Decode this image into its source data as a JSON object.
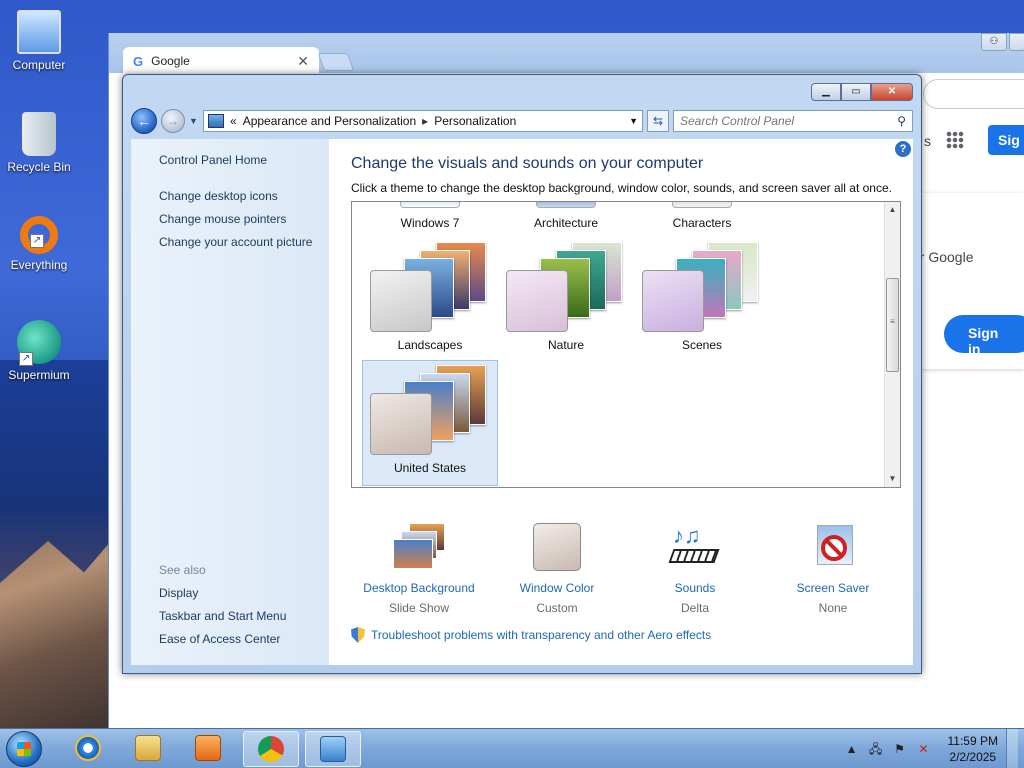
{
  "desktop": {
    "icons": [
      {
        "label": "Computer",
        "icon": "computer-icon"
      },
      {
        "label": "Recycle Bin",
        "icon": "recycle-bin-icon"
      },
      {
        "label": "Everything",
        "icon": "everything-icon"
      },
      {
        "label": "Supermium",
        "icon": "supermium-icon"
      }
    ]
  },
  "chrome": {
    "tab_title": "Google",
    "tab_favicon": "G",
    "apps_icon": "apps-grid-icon",
    "sign_in_small": "Sig",
    "card_text": "ur Google",
    "card_sign_in": "Sign in",
    "partial_s": "s",
    "colors": {
      "accent": "#1a73e8"
    }
  },
  "window": {
    "buttons": {
      "minimize": "▁",
      "maximize": "▭",
      "close": "✕"
    },
    "breadcrumb": {
      "chevrons": "«",
      "items": [
        "Appearance and Personalization",
        "Personalization"
      ],
      "separator": "▸"
    },
    "search_placeholder": "Search Control Panel"
  },
  "sidebar": {
    "home": "Control Panel Home",
    "links": [
      "Change desktop icons",
      "Change mouse pointers",
      "Change your account picture"
    ],
    "see_also_header": "See also",
    "see_also": [
      "Display",
      "Taskbar and Start Menu",
      "Ease of Access Center"
    ]
  },
  "main": {
    "title": "Change the visuals and sounds on your computer",
    "description": "Click a theme to change the desktop background, window color, sounds, and screen saver all at once.",
    "themes_row1": [
      "Windows 7",
      "Architecture",
      "Characters"
    ],
    "themes_row2": [
      "Landscapes",
      "Nature",
      "Scenes"
    ],
    "themes_row3": [
      "United States"
    ],
    "selected_theme": "United States",
    "bottom_options": [
      {
        "label": "Desktop Background",
        "value": "Slide Show",
        "icon": "desktop-background-icon"
      },
      {
        "label": "Window Color",
        "value": "Custom",
        "icon": "window-color-icon"
      },
      {
        "label": "Sounds",
        "value": "Delta",
        "icon": "sounds-icon"
      },
      {
        "label": "Screen Saver",
        "value": "None",
        "icon": "screen-saver-icon"
      }
    ],
    "troubleshoot": "Troubleshoot problems with transparency and other Aero effects"
  },
  "taskbar": {
    "items": [
      "internet-explorer-icon",
      "file-explorer-icon",
      "media-player-icon",
      "chrome-icon",
      "control-panel-icon"
    ],
    "time": "11:59 PM",
    "date": "2/2/2025"
  }
}
